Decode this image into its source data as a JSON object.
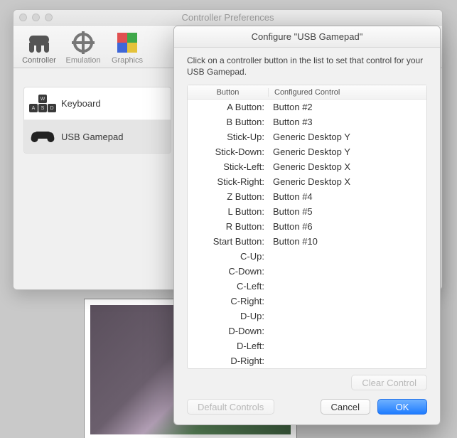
{
  "prefs": {
    "title": "Controller Preferences",
    "tabs": [
      {
        "label": "Controller",
        "name": "tab-controller"
      },
      {
        "label": "Emulation",
        "name": "tab-emulation"
      },
      {
        "label": "Graphics",
        "name": "tab-graphics"
      }
    ],
    "sources": [
      {
        "label": "Keyboard",
        "name": "source-keyboard"
      },
      {
        "label": "USB Gamepad",
        "name": "source-usb-gamepad"
      }
    ]
  },
  "config": {
    "title": "Configure \"USB Gamepad\"",
    "hint": "Click on a controller button in the list to set that control for your USB Gamepad.",
    "columns": {
      "button": "Button",
      "control": "Configured Control"
    },
    "rows": [
      {
        "button": "A Button:",
        "control": "Button #2"
      },
      {
        "button": "B Button:",
        "control": "Button #3"
      },
      {
        "button": "Stick-Up:",
        "control": "Generic Desktop Y"
      },
      {
        "button": "Stick-Down:",
        "control": "Generic Desktop Y"
      },
      {
        "button": "Stick-Left:",
        "control": "Generic Desktop X"
      },
      {
        "button": "Stick-Right:",
        "control": "Generic Desktop X"
      },
      {
        "button": "Z Button:",
        "control": "Button #4"
      },
      {
        "button": "L Button:",
        "control": "Button #5"
      },
      {
        "button": "R Button:",
        "control": "Button #6"
      },
      {
        "button": "Start Button:",
        "control": "Button #10"
      },
      {
        "button": "C-Up:",
        "control": ""
      },
      {
        "button": "C-Down:",
        "control": ""
      },
      {
        "button": "C-Left:",
        "control": ""
      },
      {
        "button": "C-Right:",
        "control": ""
      },
      {
        "button": "D-Up:",
        "control": ""
      },
      {
        "button": "D-Down:",
        "control": ""
      },
      {
        "button": "D-Left:",
        "control": ""
      },
      {
        "button": "D-Right:",
        "control": ""
      }
    ],
    "buttons": {
      "clear": "Clear Control",
      "defaults": "Default Controls",
      "cancel": "Cancel",
      "ok": "OK"
    }
  }
}
